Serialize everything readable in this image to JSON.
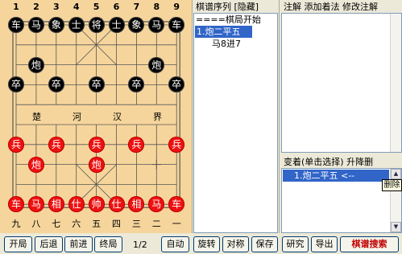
{
  "board": {
    "file_numbers_top": [
      "1",
      "2",
      "3",
      "4",
      "5",
      "6",
      "7",
      "8",
      "9"
    ],
    "file_numbers_bottom": [
      "九",
      "八",
      "七",
      "六",
      "五",
      "四",
      "三",
      "二",
      "一"
    ],
    "river_text": [
      "楚",
      "河",
      "汉",
      "界"
    ],
    "black_pieces": [
      {
        "label": "车",
        "file": 1,
        "rank": 0
      },
      {
        "label": "马",
        "file": 2,
        "rank": 0
      },
      {
        "label": "象",
        "file": 3,
        "rank": 0
      },
      {
        "label": "士",
        "file": 4,
        "rank": 0
      },
      {
        "label": "将",
        "file": 5,
        "rank": 0
      },
      {
        "label": "士",
        "file": 6,
        "rank": 0
      },
      {
        "label": "象",
        "file": 7,
        "rank": 0
      },
      {
        "label": "马",
        "file": 8,
        "rank": 0
      },
      {
        "label": "车",
        "file": 9,
        "rank": 0
      },
      {
        "label": "炮",
        "file": 2,
        "rank": 2
      },
      {
        "label": "炮",
        "file": 8,
        "rank": 2
      },
      {
        "label": "卒",
        "file": 1,
        "rank": 3
      },
      {
        "label": "卒",
        "file": 3,
        "rank": 3
      },
      {
        "label": "卒",
        "file": 5,
        "rank": 3
      },
      {
        "label": "卒",
        "file": 7,
        "rank": 3
      },
      {
        "label": "卒",
        "file": 9,
        "rank": 3
      }
    ],
    "red_pieces": [
      {
        "label": "兵",
        "file": 1,
        "rank": 6
      },
      {
        "label": "兵",
        "file": 3,
        "rank": 6
      },
      {
        "label": "兵",
        "file": 5,
        "rank": 6
      },
      {
        "label": "兵",
        "file": 7,
        "rank": 6
      },
      {
        "label": "兵",
        "file": 9,
        "rank": 6
      },
      {
        "label": "炮",
        "file": 2,
        "rank": 7
      },
      {
        "label": "炮",
        "file": 5,
        "rank": 7
      },
      {
        "label": "车",
        "file": 1,
        "rank": 9
      },
      {
        "label": "马",
        "file": 2,
        "rank": 9
      },
      {
        "label": "相",
        "file": 3,
        "rank": 9
      },
      {
        "label": "仕",
        "file": 4,
        "rank": 9
      },
      {
        "label": "帅",
        "file": 5,
        "rank": 9
      },
      {
        "label": "仕",
        "file": 6,
        "rank": 9
      },
      {
        "label": "相",
        "file": 7,
        "rank": 9
      },
      {
        "label": "马",
        "file": 8,
        "rank": 9
      },
      {
        "label": "车",
        "file": 9,
        "rank": 9
      }
    ]
  },
  "moves_panel": {
    "header": "棋谱序列 [隐藏]",
    "rows": [
      "====棋局开始",
      "1.炮二平五",
      "    马8进7"
    ],
    "selected_index": 1
  },
  "notes_panel": {
    "header": "注解 添加着法 修改注解",
    "notes_text": ""
  },
  "variation_panel": {
    "header": "变着(单击选择) 升降删",
    "row": "1.炮二平五    <--",
    "tooltip": "删除"
  },
  "toolbar": {
    "start": "开局",
    "back": "后退",
    "forward": "前进",
    "end": "终局",
    "page": "1/2",
    "auto": "自动",
    "rotate": "旋转",
    "compare": "对称",
    "save": "保存",
    "research": "研究",
    "export": "导出",
    "search": "棋谱搜索"
  },
  "colors": {
    "board": "#f6d59c",
    "black_piece": "#000000",
    "red_piece": "#ee1111",
    "selection": "#3165c8"
  }
}
